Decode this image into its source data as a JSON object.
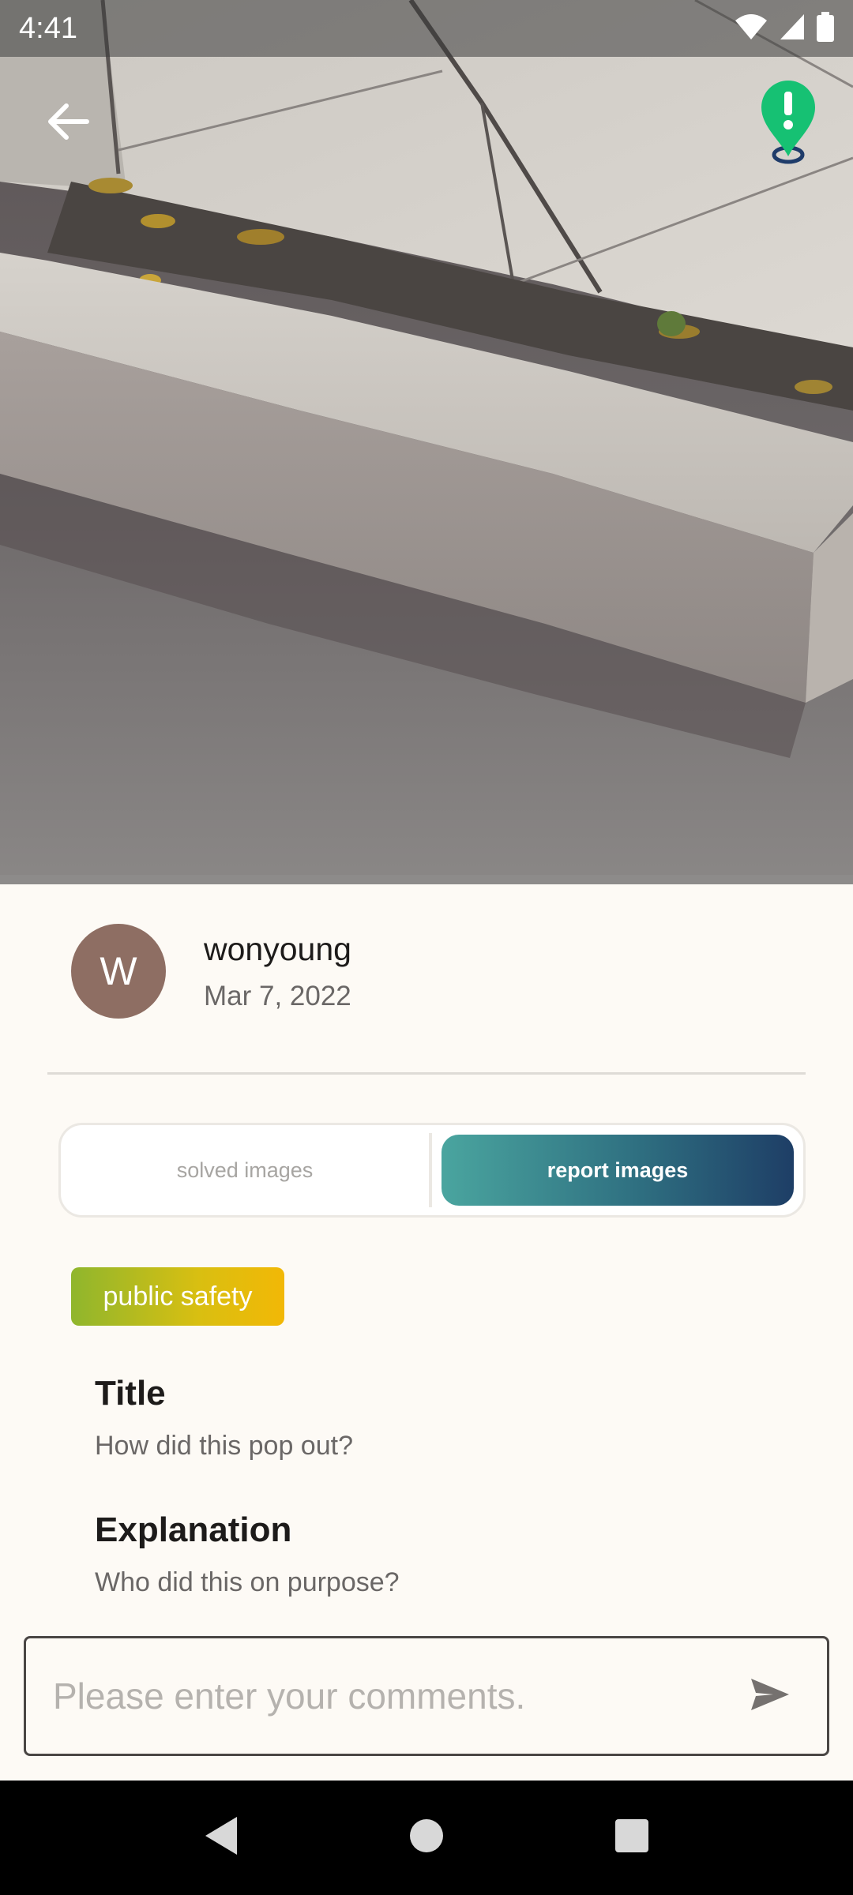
{
  "status_bar": {
    "time": "4:41",
    "icons": [
      "wifi-icon",
      "signal-icon",
      "battery-icon"
    ]
  },
  "header": {
    "back_icon": "arrow-left-icon",
    "pin_icon": "report-pin-icon",
    "pin_color": "#16C173"
  },
  "post": {
    "author": {
      "initial": "W",
      "name": "wonyoung",
      "date": "Mar 7, 2022",
      "avatar_color": "#8E6E63"
    },
    "tabs": {
      "left_label": "solved images",
      "right_label": "report images",
      "active": "report images"
    },
    "category": "public safety",
    "title_heading": "Title",
    "title_text": "How did this pop out?",
    "explanation_heading": "Explanation",
    "explanation_text": "Who did this on purpose?"
  },
  "comment": {
    "placeholder": "Please enter your comments.",
    "value": "",
    "send_icon": "send-icon"
  },
  "nav": {
    "icons": [
      "nav-back-icon",
      "nav-home-icon",
      "nav-recents-icon"
    ]
  }
}
